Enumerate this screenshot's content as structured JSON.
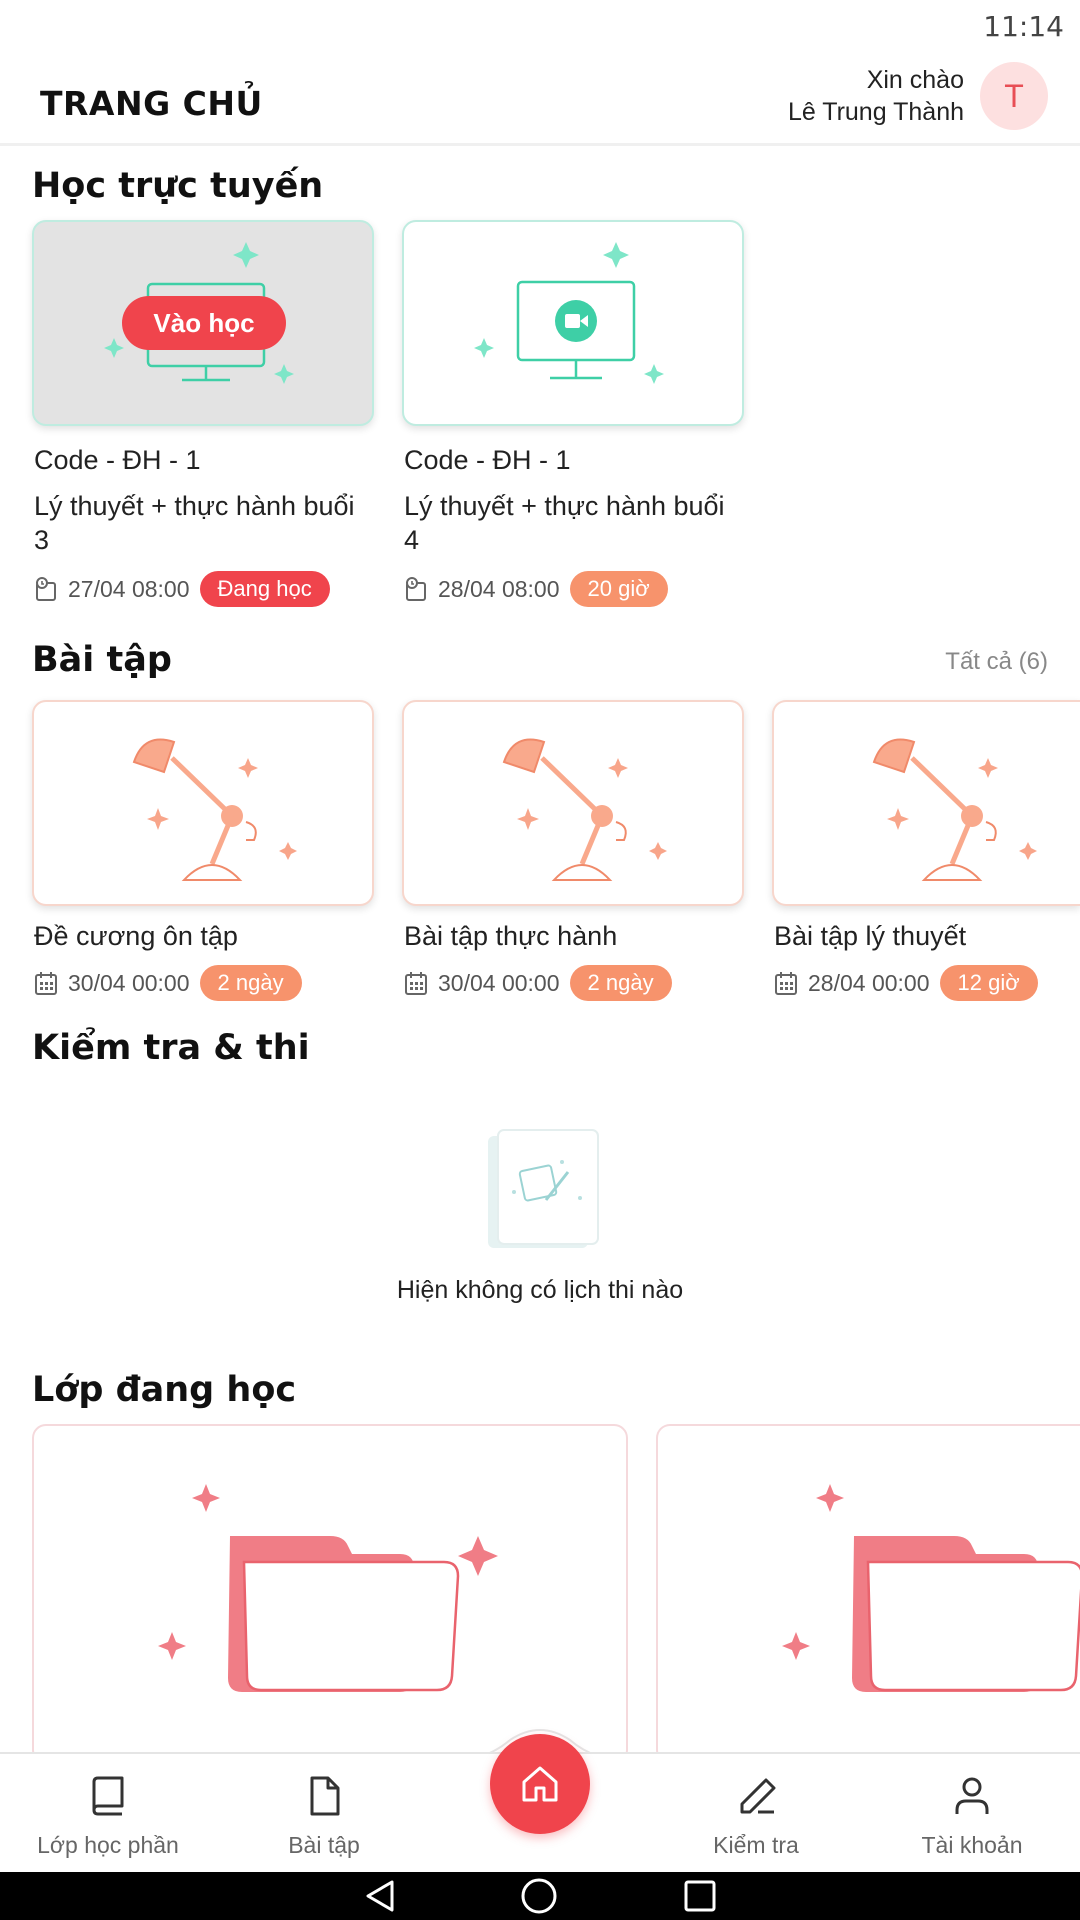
{
  "status_bar": {
    "time": "11:14"
  },
  "header": {
    "title": "TRANG CHỦ",
    "greeting": "Xin chào",
    "user_name": "Lê Trung Thành",
    "avatar_initial": "T"
  },
  "online": {
    "title": "Học trực tuyến",
    "join_label": "Vào học",
    "cards": [
      {
        "course": "Code - ĐH - 1",
        "lesson_line1": "Lý thuyết + thực hành buổi",
        "lesson_line2": "3",
        "datetime": "27/04 08:00",
        "badge": "Đang học"
      },
      {
        "course": "Code - ĐH - 1",
        "lesson_line1": "Lý thuyết + thực hành buổi",
        "lesson_line2": "4",
        "datetime": "28/04 08:00",
        "badge": "20 giờ"
      }
    ]
  },
  "assignments": {
    "title": "Bài tập",
    "see_all": "Tất cả (6)",
    "cards": [
      {
        "name": "Đề cương ôn tập",
        "datetime": "30/04 00:00",
        "badge": "2 ngày"
      },
      {
        "name": "Bài tập thực hành",
        "datetime": "30/04 00:00",
        "badge": "2 ngày"
      },
      {
        "name": "Bài tập lý thuyết",
        "datetime": "28/04 00:00",
        "badge": "12 giờ"
      }
    ]
  },
  "exams": {
    "title": "Kiểm tra & thi",
    "empty_text": "Hiện không có lịch thi nào"
  },
  "classes": {
    "title": "Lớp đang học"
  },
  "bottom_nav": {
    "items": [
      {
        "label": "Lớp học phần",
        "icon": "book-icon"
      },
      {
        "label": "Bài tập",
        "icon": "file-icon"
      },
      {
        "label": "",
        "icon": "home-icon"
      },
      {
        "label": "Kiểm tra",
        "icon": "pen-icon"
      },
      {
        "label": "Tài khoản",
        "icon": "user-icon"
      }
    ]
  },
  "colors": {
    "accent": "#f0444c",
    "badge_orange": "#f7936c",
    "teal": "#3ecfa6",
    "salmon": "#f8a58a"
  }
}
